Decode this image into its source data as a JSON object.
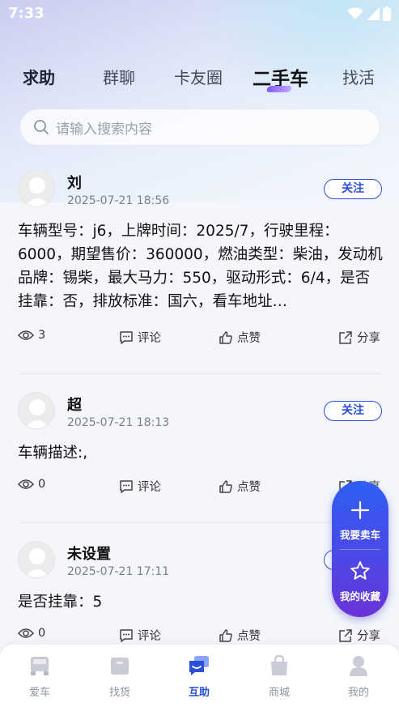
{
  "status_bar": {
    "time": "7:33"
  },
  "tabs": [
    {
      "label": "求助"
    },
    {
      "label": "群聊"
    },
    {
      "label": "卡友圈"
    },
    {
      "label": "二手车"
    },
    {
      "label": "找活"
    }
  ],
  "active_tab": "二手车",
  "search": {
    "placeholder": "请输入搜索内容"
  },
  "posts": [
    {
      "author": "刘",
      "time": "2025-07-21 18:56",
      "follow_label": "关注",
      "content": "车辆型号：j6，上牌时间：2025/7，行驶里程：6000，期望售价：360000，燃油类型：柴油，发动机品牌：锡柴，最大马力：550，驱动形式：6/4，是否挂靠：否，排放标准：国六，看车地址…",
      "views": "3",
      "comment_label": "评论",
      "like_label": "点赞",
      "share_label": "分享"
    },
    {
      "author": "超",
      "time": "2025-07-21 18:13",
      "follow_label": "关注",
      "content": "车辆描述:,",
      "views": "0",
      "comment_label": "评论",
      "like_label": "点赞",
      "share_label": "分享"
    },
    {
      "author": "未设置",
      "time": "2025-07-21 17:11",
      "follow_label": "关注",
      "content": "是否挂靠：5",
      "views": "0",
      "comment_label": "评论",
      "like_label": "点赞",
      "share_label": "分享"
    }
  ],
  "fab": {
    "sell_label": "我要卖车",
    "favorites_label": "我的收藏"
  },
  "bottom_nav": [
    {
      "label": "爱车",
      "icon": "truck-icon"
    },
    {
      "label": "找货",
      "icon": "box-icon"
    },
    {
      "label": "互助",
      "icon": "chat-icon"
    },
    {
      "label": "商城",
      "icon": "shopping-bag-icon"
    },
    {
      "label": "我的",
      "icon": "user-icon"
    }
  ],
  "active_nav": "互助",
  "colors": {
    "accent": "#2a4fd8",
    "fab_gradient_start": "#2f5ef3",
    "fab_gradient_end": "#6a33d8"
  }
}
